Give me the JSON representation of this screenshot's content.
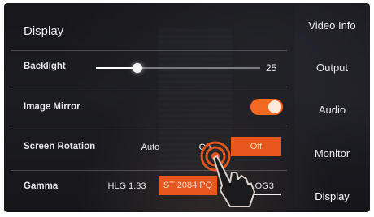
{
  "page": {
    "title": "Display"
  },
  "rows": {
    "backlight": {
      "label": "Backlight",
      "value": "25",
      "level": 0.25
    },
    "image_mirror": {
      "label": "Image Mirror",
      "state": "on"
    },
    "screen_rotation": {
      "label": "Screen Rotation",
      "options": [
        "Auto",
        "On",
        "Off"
      ],
      "selected": "Off"
    },
    "gamma": {
      "label": "Gamma",
      "options": [
        "HLG 1.33",
        "ST 2084 PQ",
        "S LOG3"
      ],
      "selected": "ST 2084 PQ",
      "focused": "S LOG3"
    }
  },
  "menu": {
    "items": [
      "Video Info",
      "Output",
      "Audio",
      "Monitor",
      "Display"
    ],
    "active": "Display"
  },
  "colors": {
    "accent": "#f26a22",
    "background": "#1e1e22",
    "text": "#e8e8ee"
  },
  "icons": {
    "touch_gesture": "hand-tap-icon"
  }
}
